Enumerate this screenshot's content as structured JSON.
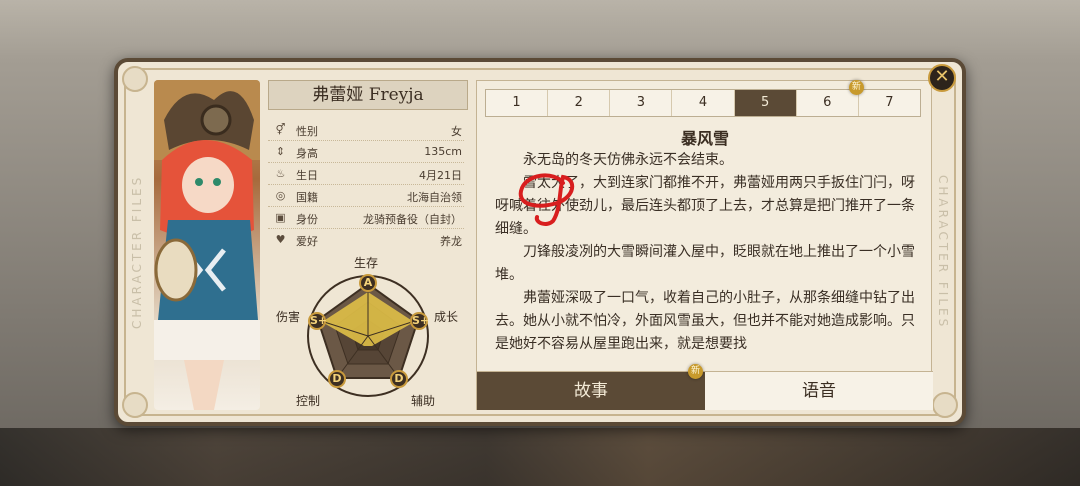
{
  "character": {
    "name": "弗蕾娅 Freyja",
    "side_label": "CHARACTER FILES"
  },
  "info": [
    {
      "icon": "gender-icon",
      "glyph": "⚥",
      "label": "性别",
      "value": "女"
    },
    {
      "icon": "height-icon",
      "glyph": "⇕",
      "label": "身高",
      "value": "135cm"
    },
    {
      "icon": "birthday-cake-icon",
      "glyph": "♨",
      "label": "生日",
      "value": "4月21日"
    },
    {
      "icon": "globe-icon",
      "glyph": "◎",
      "label": "国籍",
      "value": "北海自治领"
    },
    {
      "icon": "id-card-icon",
      "glyph": "▣",
      "label": "身份",
      "value": "龙骑预备役（自封）"
    },
    {
      "icon": "heart-icon",
      "glyph": "♥",
      "label": "爱好",
      "value": "养龙"
    }
  ],
  "radar": {
    "axes": [
      {
        "label": "生存",
        "grade": "A"
      },
      {
        "label": "成长",
        "grade": "S+"
      },
      {
        "label": "辅助",
        "grade": "D"
      },
      {
        "label": "控制",
        "grade": "D"
      },
      {
        "label": "伤害",
        "grade": "S+"
      }
    ]
  },
  "chapters": {
    "tabs": [
      "1",
      "2",
      "3",
      "4",
      "5",
      "6",
      "7"
    ],
    "active_index": 4,
    "new_tab_index": 5,
    "new_label": "新"
  },
  "story": {
    "title": "暴风雪",
    "paragraphs": [
      "永无岛的冬天仿佛永远不会结束。",
      "雪太大了，大到连家门都推不开，弗蕾娅用两只手扳住门闩，呀呀喊着往外使劲儿，最后连头都顶了上去，才总算是把门推开了一条细缝。",
      "刀锋般凌冽的大雪瞬间灌入屋中，眨眼就在地上推出了一个小雪堆。",
      "弗蕾娅深吸了一口气，收着自己的小肚子，从那条细缝中钻了出去。她从小就不怕冷，外面风雪虽大，但也并不能对她造成影响。只是她好不容易从屋里跑出来，就是想要找"
    ]
  },
  "bottom_tabs": {
    "story_label": "故事",
    "voice_label": "语音",
    "new_label": "新"
  },
  "close_glyph": "✕",
  "colors": {
    "accent": "#5b4a36",
    "gold": "#c89a3c",
    "paper": "#efe6d4",
    "annotation_red": "#d81e1e"
  }
}
